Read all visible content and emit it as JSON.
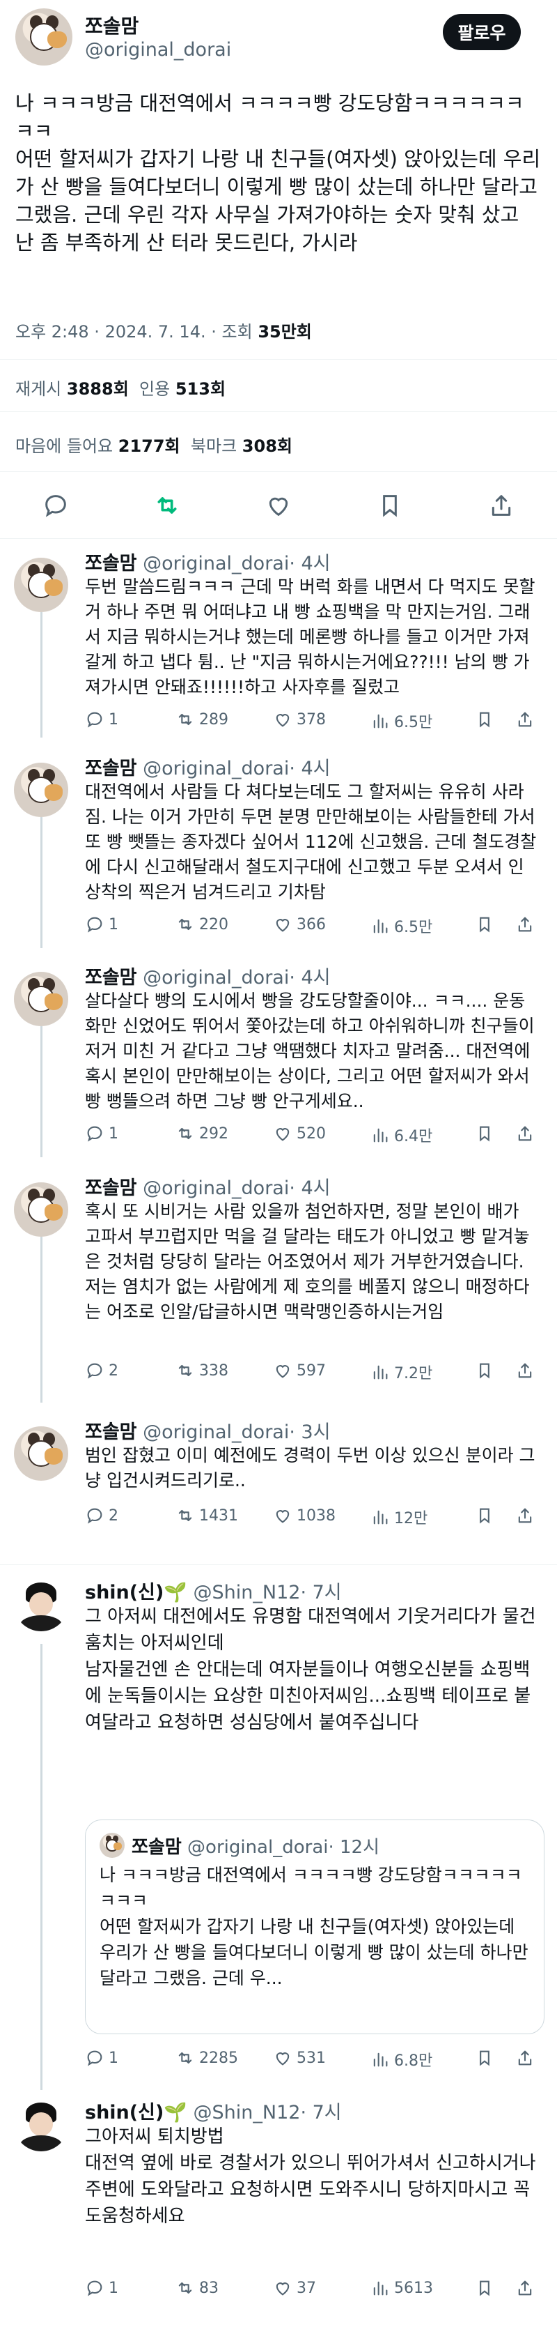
{
  "main_tweet": {
    "author_name": "쪼솔맘",
    "handle": "@original_dorai",
    "follow_label": "팔로우",
    "text": "나 ㅋㅋㅋ방금 대전역에서 ㅋㅋㅋㅋ빵 강도당함ㅋㅋㅋㅋㅋㅋㅋㅋ\n어떤 할저씨가 갑자기 나랑 내 친구들(여자셋) 앉아있는데 우리가 산 빵을 들여다보더니 이렇게 빵 많이 샀는데 하나만 달라고 그랬음. 근데 우린 각자 사무실 가져가야하는 숫자 맞춰 샀고 난 좀 부족하게 산 터라 못드린다, 가시라",
    "time": "오후 2:48 · 2024. 7. 14.",
    "views_label": "조회",
    "views": "35만회",
    "reposts_label": "재게시",
    "reposts": "3888회",
    "quotes_label": "인용",
    "quotes": "513회",
    "likes_label": "마음에 들어요",
    "likes": "2177회",
    "bookmarks_label": "북마크",
    "bookmarks": "308회"
  },
  "replies": [
    {
      "name": "쪼솔맘",
      "handle": "@original_dorai",
      "time": "· 4시",
      "text": "두번 말씀드림ㅋㅋㅋ 근데 막 버럭 화를 내면서 다 먹지도 못할거 하나 주면 뭐 어떠냐고 내 빵 쇼핑백을 막 만지는거임. 그래서 지금 뭐하시는거냐 했는데 메론빵 하나를 들고 이거만 가져갈게 하고 냅다 튐.. 난 \"지금 뭐하시는거에요??!!! 남의 빵 가져가시면 안돼죠!!!!!!하고 사자후를 질렀고",
      "replies": "1",
      "reposts": "289",
      "likes": "378",
      "views": "6.5만"
    },
    {
      "name": "쪼솔맘",
      "handle": "@original_dorai",
      "time": "· 4시",
      "text": "대전역에서 사람들 다 쳐다보는데도 그 할저씨는 유유히 사라짐. 나는 이거 가만히 두면 분명 만만해보이는 사람들한테 가서 또 빵 뺏뜰는 종자겠다 싶어서 112에 신고했음. 근데 철도경찰에 다시 신고해달래서 철도지구대에 신고했고 두분 오셔서 인상착의 찍은거 넘겨드리고 기차탐",
      "replies": "1",
      "reposts": "220",
      "likes": "366",
      "views": "6.5만"
    },
    {
      "name": "쪼솔맘",
      "handle": "@original_dorai",
      "time": "· 4시",
      "text": "살다살다 빵의 도시에서 빵을 강도당할줄이야... ㅋㅋ.... 운동화만 신었어도 뛰어서 쫓아갔는데 하고 아쉬워하니까 친구들이 저거 미친 거 같다고 그냥 액땜했다 치자고 말려줌... 대전역에 혹시 본인이 만만해보이는 상이다, 그리고 어떤 할저씨가 와서 빵 뻥뜰으려 하면 그냥 빵 안구게세요..",
      "replies": "1",
      "reposts": "292",
      "likes": "520",
      "views": "6.4만"
    },
    {
      "name": "쪼솔맘",
      "handle": "@original_dorai",
      "time": "· 4시",
      "text": "혹시 또 시비거는 사람 있을까 첨언하자면, 정말 본인이 배가 고파서 부끄럽지만 먹을 걸 달라는 태도가 아니었고 빵 맡겨놓은 것처럼 당당히 달라는 어조였어서 제가 거부한거였습니다. 저는 염치가 없는 사람에게 제 호의를 베풀지 않으니 매정하다는 어조로 인알/답글하시면 맥락맹인증하시는거임",
      "replies": "2",
      "reposts": "338",
      "likes": "597",
      "views": "7.2만"
    },
    {
      "name": "쪼솔맘",
      "handle": "@original_dorai",
      "time": "· 3시",
      "text": "범인 잡혔고 이미 예전에도 경력이 두번 이상 있으신 분이라 그냥 입건시켜드리기로..",
      "replies": "2",
      "reposts": "1431",
      "likes": "1038",
      "views": "12만"
    },
    {
      "name": "shin(신)🌱",
      "handle": "@Shin_N12",
      "time": "· 7시",
      "text": "그 아저씨 대전에서도 유명함 대전역에서 기웃거리다가 물건훔치는 아저씨인데\n남자물건엔 손 안대는데 여자분들이나 여행오신분들 쇼핑백에 눈독들이시는 요상한 미친아저씨임...쇼핑백 테이프로 붙여달라고 요청하면 성심당에서 붙여주십니다",
      "quote": {
        "name": "쪼솔맘",
        "handle": "@original_dorai",
        "time": "· 12시",
        "text": "나 ㅋㅋㅋ방금 대전역에서 ㅋㅋㅋㅋ빵 강도당함ㅋㅋㅋㅋㅋㅋㅋㅋ\n어떤 할저씨가 갑자기 나랑 내 친구들(여자셋) 앉아있는데 우리가 산 빵을 들여다보더니 이렇게 빵 많이 샀는데 하나만 달라고 그랬음. 근데 우..."
      },
      "replies": "1",
      "reposts": "2285",
      "likes": "531",
      "views": "6.8만"
    },
    {
      "name": "shin(신)🌱",
      "handle": "@Shin_N12",
      "time": "· 7시",
      "text": "그아저씨 퇴치방법\n대전역 옆에 바로 경찰서가 있으니 뛰어가셔서 신고하시거나 주변에 도와달라고 요청하시면 도와주시니 당하지마시고 꼭 도움청하세요",
      "replies": "1",
      "reposts": "83",
      "likes": "37",
      "views": "5613"
    }
  ]
}
